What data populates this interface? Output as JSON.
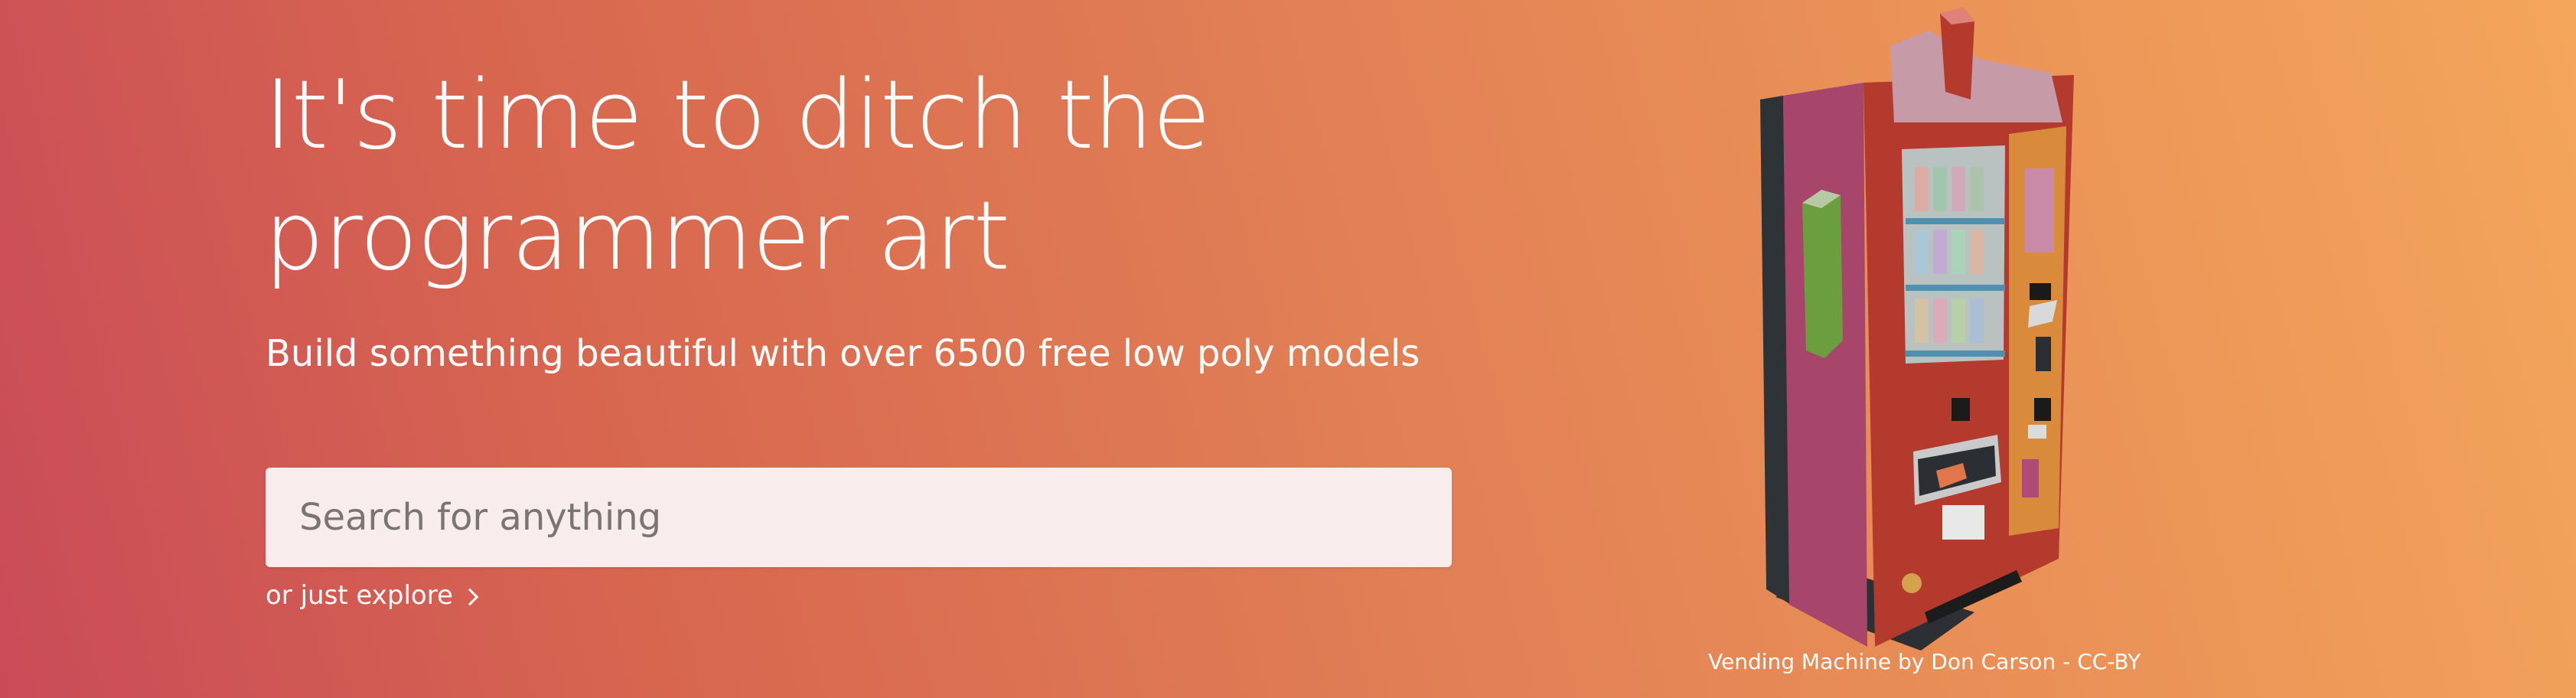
{
  "hero": {
    "headline_line1": "It's time to ditch the",
    "headline_line2": "programmer art",
    "subheadline": "Build something beautiful with over 6500 free low poly models",
    "search": {
      "placeholder": "Search for anything",
      "value": ""
    },
    "explore_link": "or just explore",
    "model_caption": "Vending Machine by Don Carson - CC-BY"
  },
  "colors": {
    "gradient_start": "#c94b58",
    "gradient_end": "#f4a65b",
    "text": "#ffffff",
    "search_background": "#f8ecec"
  },
  "icons": {
    "explore_arrow": "chevron-right-icon"
  }
}
